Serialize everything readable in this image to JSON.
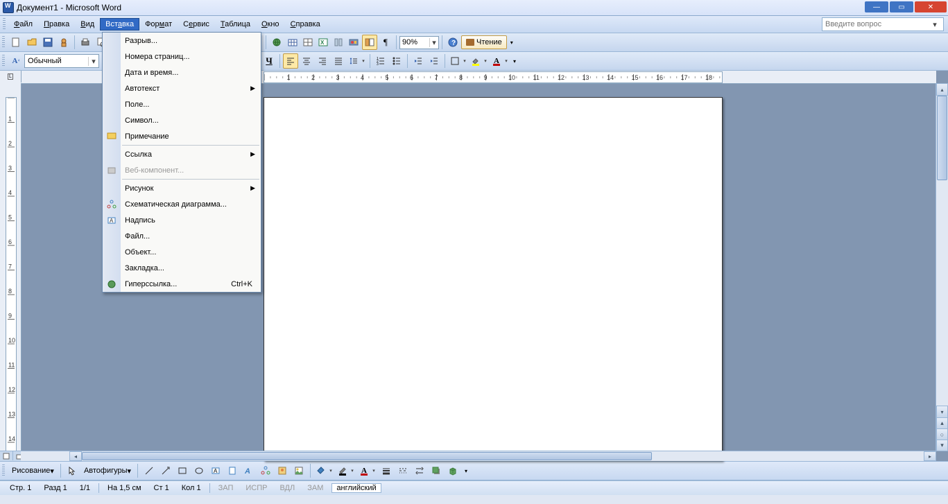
{
  "titlebar": {
    "title": "Документ1 - Microsoft Word"
  },
  "menubar": {
    "file": "Файл",
    "edit": "Правка",
    "view": "Вид",
    "insert": "Вставка",
    "format": "Формат",
    "service": "Сервис",
    "table": "Таблица",
    "window": "Окно",
    "help": "Справка",
    "question_placeholder": "Введите вопрос"
  },
  "toolbar": {
    "zoom": "90%",
    "reading": "Чтение"
  },
  "formatting": {
    "style": "Обычный"
  },
  "dropdown": {
    "break": "Разрыв...",
    "pagenum": "Номера страниц...",
    "datetime": "Дата и время...",
    "autotext": "Автотекст",
    "field": "Поле...",
    "symbol": "Символ...",
    "comment": "Примечание",
    "reference": "Ссылка",
    "webcomp": "Веб-компонент...",
    "picture": "Рисунок",
    "diagram": "Схематическая диаграмма...",
    "textbox": "Надпись",
    "file": "Файл...",
    "object": "Объект...",
    "bookmark": "Закладка...",
    "hyperlink": "Гиперссылка...",
    "hyperlink_shortcut": "Ctrl+K"
  },
  "drawbar": {
    "drawing": "Рисование",
    "autoshapes": "Автофигуры"
  },
  "statusbar": {
    "page": "Стр. 1",
    "section": "Разд 1",
    "pages": "1/1",
    "at": "На 1,5 см",
    "line": "Ст 1",
    "col": "Кол 1",
    "rec": "ЗАП",
    "trk": "ИСПР",
    "ext": "ВДЛ",
    "ovr": "ЗАМ",
    "lang": "английский"
  }
}
